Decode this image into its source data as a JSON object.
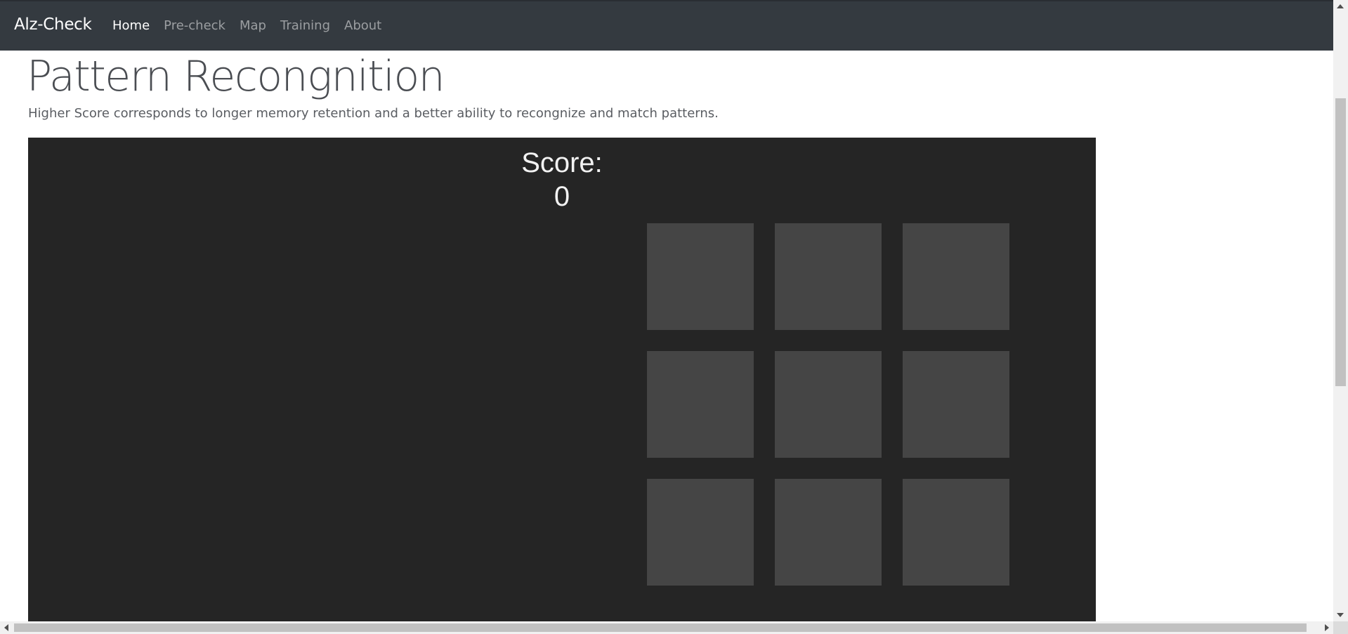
{
  "navbar": {
    "brand": "Alz-Check",
    "links": [
      {
        "label": "Home",
        "active": true
      },
      {
        "label": "Pre-check",
        "active": false
      },
      {
        "label": "Map",
        "active": false
      },
      {
        "label": "Training",
        "active": false
      },
      {
        "label": "About",
        "active": false
      }
    ]
  },
  "main": {
    "title": "Pattern Recongnition",
    "subtitle": "Higher Score corresponds to longer memory retention and a better ability to recongnize and match patterns."
  },
  "game": {
    "score_label": "Score:",
    "score_value": "0",
    "grid_rows": 3,
    "grid_cols": 3,
    "colors": {
      "background": "#252525",
      "tile": "#454545",
      "text": "#f2f2f2"
    }
  },
  "colors": {
    "navbar": "#343a40",
    "nav_active": "#ffffff",
    "nav_inactive": "rgba(255,255,255,0.5)"
  }
}
